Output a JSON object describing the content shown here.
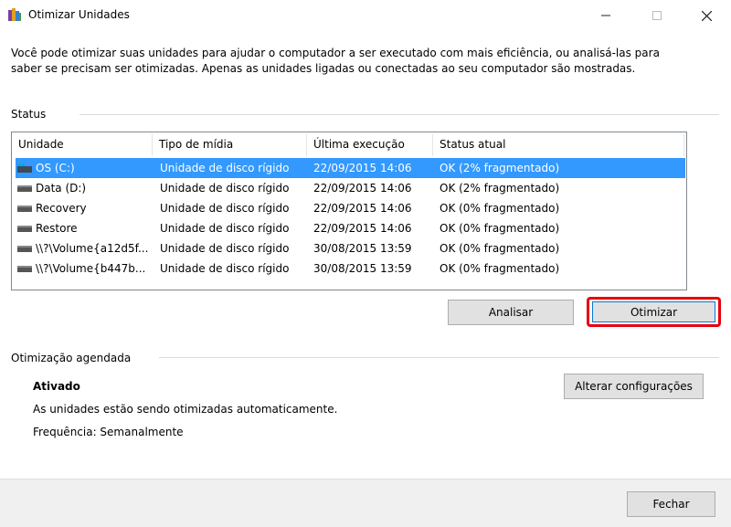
{
  "window": {
    "title": "Otimizar Unidades",
    "min_glyph": "—",
    "max_glyph": "☐",
    "close_glyph": "✕"
  },
  "intro": {
    "line1": "Você pode otimizar suas unidades para ajudar o computador a ser executado com mais eficiência, ou analisá-las para",
    "line2": "saber se precisam ser otimizadas. Apenas as unidades ligadas ou conectadas ao seu computador são mostradas."
  },
  "status_group": {
    "label": "Status"
  },
  "table": {
    "columns": [
      "Unidade",
      "Tipo de mídia",
      "Última execução",
      "Status atual"
    ],
    "rows": [
      {
        "unit": "OS (C:)",
        "media": "Unidade de disco rígido",
        "last_run": "22/09/2015 14:06",
        "status": "OK (2% fragmentado)",
        "icon": "windows-drive-icon",
        "selected": true
      },
      {
        "unit": "Data (D:)",
        "media": "Unidade de disco rígido",
        "last_run": "22/09/2015 14:06",
        "status": "OK (2% fragmentado)",
        "icon": "hard-drive-icon",
        "selected": false
      },
      {
        "unit": "Recovery",
        "media": "Unidade de disco rígido",
        "last_run": "22/09/2015 14:06",
        "status": "OK (0% fragmentado)",
        "icon": "hard-drive-icon",
        "selected": false
      },
      {
        "unit": "Restore",
        "media": "Unidade de disco rígido",
        "last_run": "22/09/2015 14:06",
        "status": "OK (0% fragmentado)",
        "icon": "hard-drive-icon",
        "selected": false
      },
      {
        "unit": "\\\\?\\Volume{a12d5f...",
        "media": "Unidade de disco rígido",
        "last_run": "30/08/2015 13:59",
        "status": "OK (0% fragmentado)",
        "icon": "hard-drive-icon",
        "selected": false
      },
      {
        "unit": "\\\\?\\Volume{b447b...",
        "media": "Unidade de disco rígido",
        "last_run": "30/08/2015 13:59",
        "status": "OK (0% fragmentado)",
        "icon": "hard-drive-icon",
        "selected": false
      }
    ]
  },
  "buttons": {
    "analyze": "Analisar",
    "optimize": "Otimizar",
    "change_settings": "Alterar configurações",
    "close": "Fechar"
  },
  "schedule_group": {
    "label": "Otimização agendada",
    "status": "Ativado",
    "description": "As unidades estão sendo otimizadas automaticamente.",
    "frequency": "Frequência: Semanalmente"
  },
  "colors": {
    "selection": "#3399ff",
    "highlight": "#e8000d"
  }
}
